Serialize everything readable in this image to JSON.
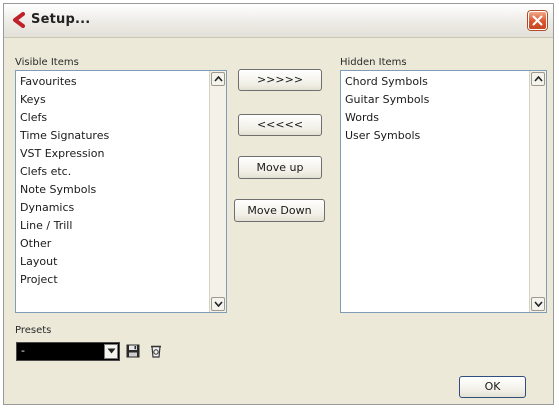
{
  "window": {
    "title": "Setup..."
  },
  "visible_items": {
    "label": "Visible Items",
    "items": [
      "Favourites",
      "Keys",
      "Clefs",
      "Time Signatures",
      "VST Expression",
      "Clefs etc.",
      "Note Symbols",
      "Dynamics",
      "Line / Trill",
      "Other",
      "Layout",
      "Project"
    ]
  },
  "hidden_items": {
    "label": "Hidden Items",
    "items": [
      "Chord Symbols",
      "Guitar Symbols",
      "Words",
      "User Symbols"
    ]
  },
  "buttons": {
    "hide": ">>>>>",
    "show": "<<<<<",
    "move_up": "Move up",
    "move_down": "Move Down",
    "ok": "OK"
  },
  "presets": {
    "label": "Presets",
    "value": "-"
  },
  "colors": {
    "accent_close": "#d9552f",
    "list_border": "#7f9db9",
    "window_bg": "#ece9d8"
  },
  "icons": {
    "app": "cubase-logo-icon",
    "close": "close-icon",
    "save": "save-icon",
    "delete": "delete-icon"
  }
}
